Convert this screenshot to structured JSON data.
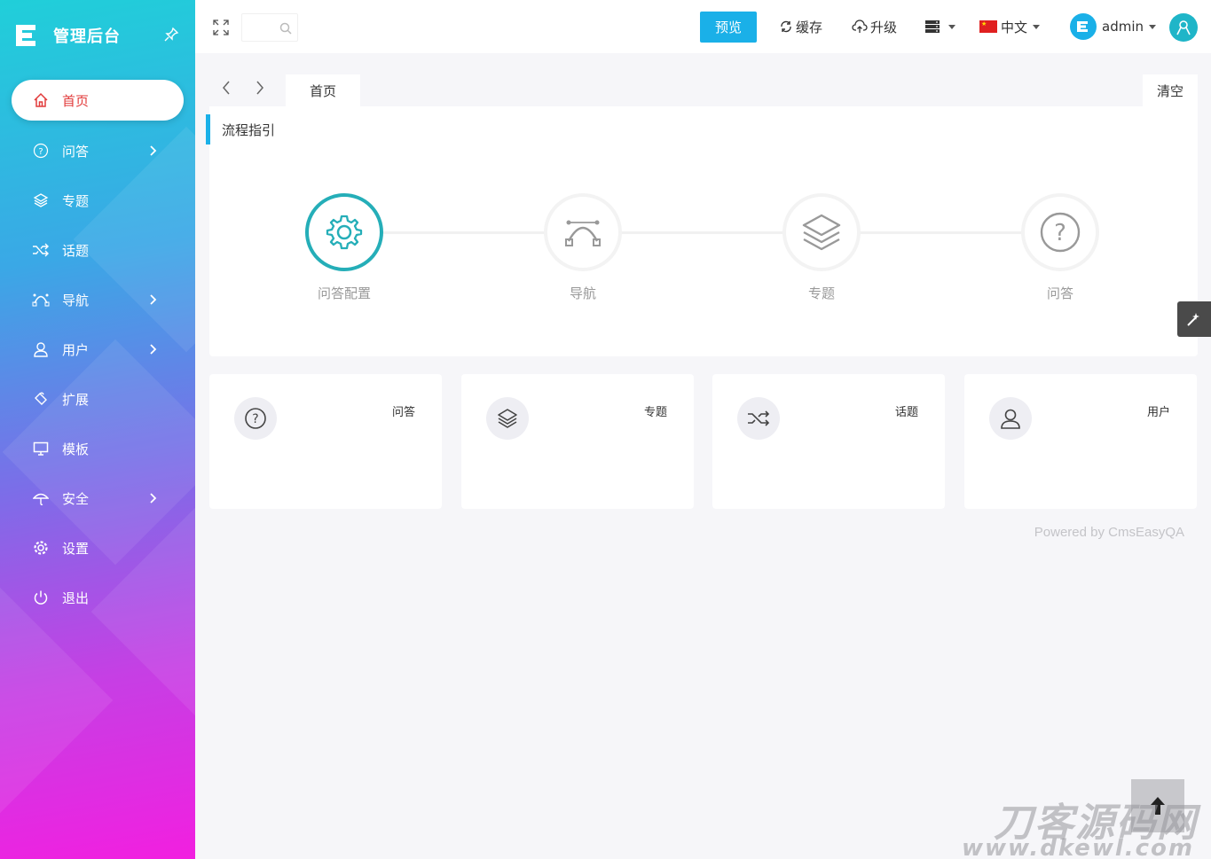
{
  "sidebar": {
    "brand_title": "管理后台",
    "items": [
      {
        "label": "首页",
        "icon": "home-icon",
        "active": true,
        "has_children": false
      },
      {
        "label": "问答",
        "icon": "question-circle-icon",
        "has_children": true
      },
      {
        "label": "专题",
        "icon": "layers-icon",
        "has_children": false
      },
      {
        "label": "话题",
        "icon": "shuffle-icon",
        "has_children": false
      },
      {
        "label": "导航",
        "icon": "bezier-icon",
        "has_children": true
      },
      {
        "label": "用户",
        "icon": "user-icon",
        "has_children": true
      },
      {
        "label": "扩展",
        "icon": "puzzle-icon",
        "has_children": false
      },
      {
        "label": "模板",
        "icon": "monitor-icon",
        "has_children": false
      },
      {
        "label": "安全",
        "icon": "umbrella-icon",
        "has_children": true
      },
      {
        "label": "设置",
        "icon": "gear-icon",
        "has_children": false
      },
      {
        "label": "退出",
        "icon": "power-icon",
        "has_children": false
      }
    ]
  },
  "topbar": {
    "preview_label": "预览",
    "cache_label": "缓存",
    "upgrade_label": "升级",
    "language_label": "中文",
    "user_label": "admin",
    "accent_color": "#1ab0e8"
  },
  "tabs": {
    "home_label": "首页",
    "clear_label": "清空"
  },
  "guide": {
    "title": "流程指引",
    "steps": [
      {
        "label": "问答配置",
        "icon": "gear-icon",
        "active": true
      },
      {
        "label": "导航",
        "icon": "bezier-icon",
        "active": false
      },
      {
        "label": "专题",
        "icon": "layers-icon",
        "active": false
      },
      {
        "label": "问答",
        "icon": "question-circle-icon",
        "active": false
      }
    ]
  },
  "stats": [
    {
      "label": "问答",
      "icon": "question-circle-icon"
    },
    {
      "label": "专题",
      "icon": "layers-icon"
    },
    {
      "label": "话题",
      "icon": "shuffle-icon"
    },
    {
      "label": "用户",
      "icon": "user-icon"
    }
  ],
  "footer": {
    "powered_by": "Powered by CmsEasyQA"
  },
  "watermark": {
    "big": "刀客源码网",
    "small": "www.dkewl.com"
  }
}
